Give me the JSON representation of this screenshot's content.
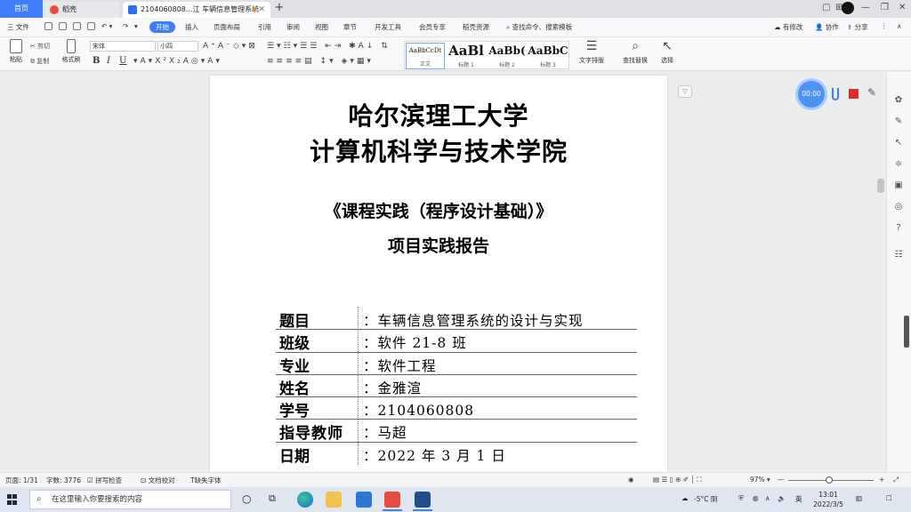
{
  "tabs": {
    "home": "首页",
    "daoke": "稻壳",
    "doc": "2104060808...江 车辆信息管理系统"
  },
  "menu": {
    "file": "三 文件",
    "items": [
      "开始",
      "插入",
      "页面布局",
      "引用",
      "审阅",
      "视图",
      "章节",
      "开发工具",
      "会员专享",
      "稻壳资源"
    ],
    "search": "查找命令、搜索模板",
    "right": [
      "有修改",
      "协作",
      "分享"
    ]
  },
  "ribbon": {
    "paste": "粘贴",
    "cut": "剪切",
    "copy": "复制",
    "format_painter": "格式刷",
    "font": "宋体",
    "size": "小四",
    "styles": [
      {
        "preview": "AaBbCcDt",
        "label": "正文"
      },
      {
        "preview": "AaBl",
        "label": "标题 1"
      },
      {
        "preview": "AaBb(",
        "label": "标题 2"
      },
      {
        "preview": "AaBbC",
        "label": "标题 3"
      }
    ],
    "text_layout": "文字排版",
    "find_replace": "查找替换",
    "select": "选择"
  },
  "document": {
    "title_line1": "哈尔滨理工大学",
    "title_line2": "计算机科学与技术学院",
    "course": "《课程实践（程序设计基础）》",
    "report": "项目实践报告",
    "fields": [
      {
        "label": "题目",
        "value": "车辆信息管理系统的设计与实现"
      },
      {
        "label": "班级",
        "value": "软件 21-8 班"
      },
      {
        "label": "专业",
        "value": "软件工程"
      },
      {
        "label": "姓名",
        "value": "金雅渲"
      },
      {
        "label": "学号",
        "value": "2104060808"
      },
      {
        "label": "指导教师",
        "value": "马超"
      },
      {
        "label": "日期",
        "value": "2022 年 3 月 1 日"
      }
    ],
    "colon": "："
  },
  "recorder": {
    "time": "00:00"
  },
  "status": {
    "page": "页面: 1/31",
    "words": "字数: 3776",
    "spell": "拼写检查",
    "proof": "文档校对",
    "font_missing": "缺失字体",
    "zoom": "97%"
  },
  "taskbar": {
    "search_placeholder": "在这里输入你要搜索的内容",
    "weather": "-5°C 阴",
    "ime": "英",
    "time": "13:01",
    "date": "2022/3/5"
  },
  "colors": {
    "accent": "#3f7ef8",
    "wps_red": "#e84a3c",
    "record_red": "#e12a2a"
  }
}
